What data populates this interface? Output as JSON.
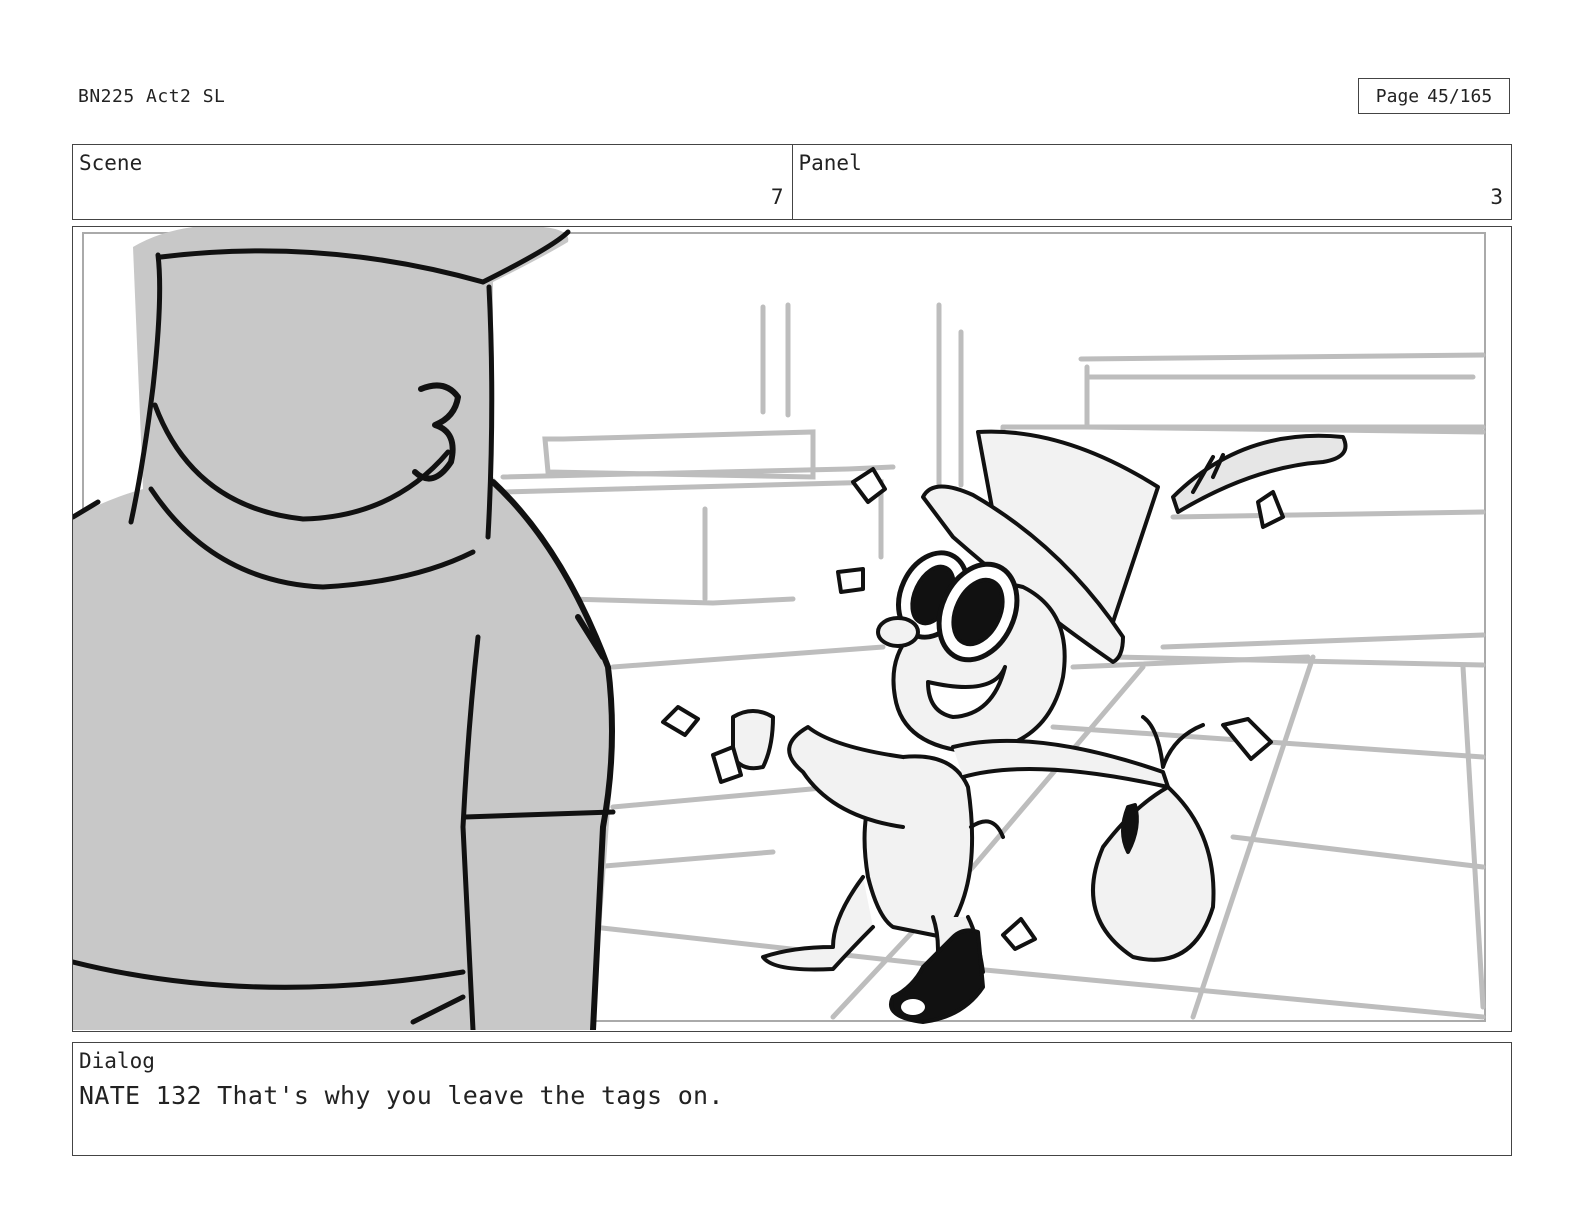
{
  "header": {
    "doc_title": "BN225 Act2 SL",
    "page_label": "Page",
    "page_number": "45/165"
  },
  "info": {
    "scene_label": "Scene",
    "scene_value": "7",
    "panel_label": "Panel",
    "panel_value": "3"
  },
  "artwork": {
    "background_gray": "#c8c8c8",
    "line_color": "#111111",
    "sketch_gray": "#bdbdbd"
  },
  "dialog": {
    "label": "Dialog",
    "text": "NATE 132 That's why you leave the tags on."
  }
}
